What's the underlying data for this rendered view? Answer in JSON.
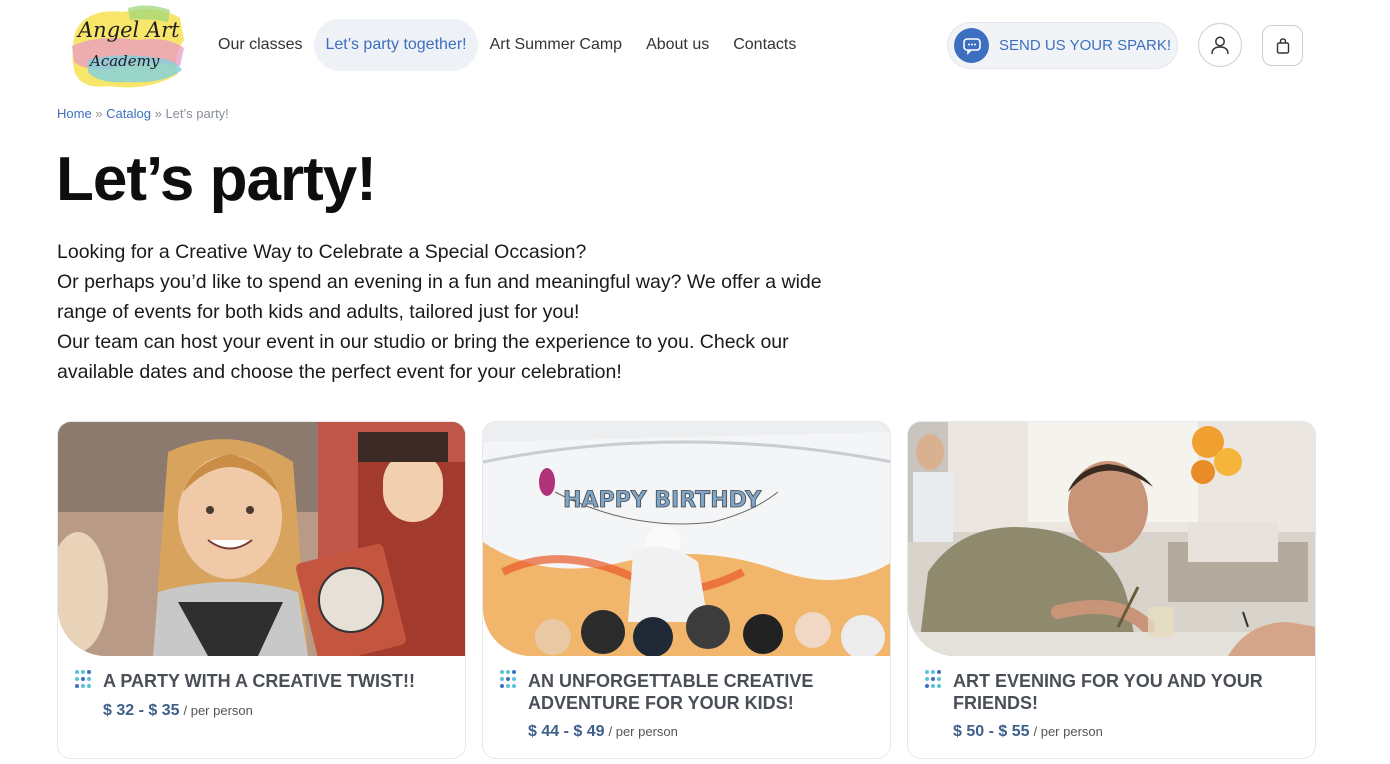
{
  "logo": {
    "line1": "Angel Art",
    "line2": "Academy"
  },
  "nav": {
    "items": [
      {
        "label": "Our classes"
      },
      {
        "label": "Let’s party together!"
      },
      {
        "label": "Art Summer Camp"
      },
      {
        "label": "About us"
      },
      {
        "label": "Contacts"
      }
    ],
    "active_index": 1
  },
  "header": {
    "spark_label": "SEND US YOUR SPARK!",
    "spark_icon": "chat-icon",
    "account_icon": "user-icon",
    "cart_icon": "bag-icon"
  },
  "breadcrumb": {
    "home": "Home",
    "sep1": " » ",
    "catalog": "Catalog",
    "sep2": " » ",
    "current": "Let’s party!"
  },
  "page": {
    "title": "Let’s party!",
    "intro": [
      "Looking for a Creative Way to Celebrate a Special Occasion?",
      "Or perhaps you’d like to spend an evening in a fun and meaningful way? We offer a wide range of events for both kids and adults, tailored just for you!",
      "Our team can host your event in our studio or bring the experience to you. Check our available dates and choose the perfect event for your celebration!"
    ]
  },
  "cards": [
    {
      "title": "A PARTY WITH A CREATIVE TWIST!!",
      "price": "$ 32 - $ 35",
      "unit": "/ per person"
    },
    {
      "title": "AN UNFORGETTABLE CREATIVE ADVENTURE FOR YOUR KIDS!",
      "price": "$ 44 - $ 49",
      "unit": "/ per person",
      "banner_text": "HAPPY BIRTHDY"
    },
    {
      "title": "ART EVENING FOR YOU AND YOUR FRIENDS!",
      "price": "$ 50 - $ 55",
      "unit": "/ per person"
    }
  ],
  "colors": {
    "accent": "#3d6fc0",
    "price": "#3e5f8a",
    "dots": "#5bc3d6"
  }
}
